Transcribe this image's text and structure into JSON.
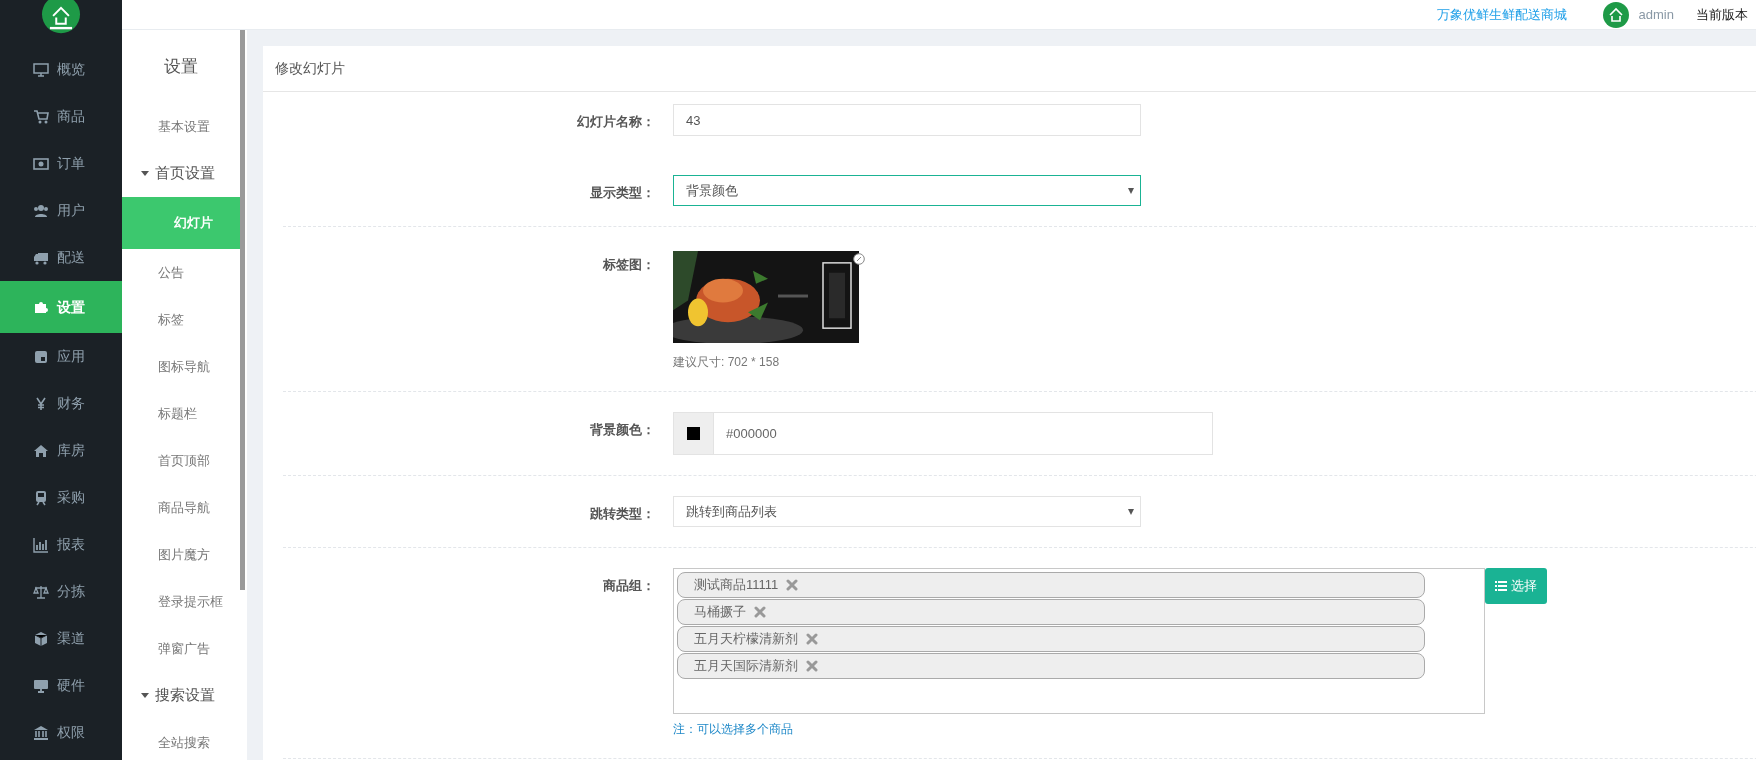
{
  "topbar": {
    "shop_link": "万象优鲜生鲜配送商城",
    "user": "admin",
    "version_label": "当前版本"
  },
  "nav": [
    {
      "label": "概览",
      "selected": false
    },
    {
      "label": "商品",
      "selected": false
    },
    {
      "label": "订单",
      "selected": false
    },
    {
      "label": "用户",
      "selected": false
    },
    {
      "label": "配送",
      "selected": false
    },
    {
      "label": "设置",
      "selected": true
    },
    {
      "label": "应用",
      "selected": false
    },
    {
      "label": "财务",
      "selected": false
    },
    {
      "label": "库房",
      "selected": false
    },
    {
      "label": "采购",
      "selected": false
    },
    {
      "label": "报表",
      "selected": false
    },
    {
      "label": "分拣",
      "selected": false
    },
    {
      "label": "渠道",
      "selected": false
    },
    {
      "label": "硬件",
      "selected": false
    },
    {
      "label": "权限",
      "selected": false
    }
  ],
  "subnav": {
    "title": "设置",
    "items": [
      {
        "label": "基本设置",
        "selected": false
      },
      {
        "label": "首页设置",
        "expanded": true,
        "children": [
          {
            "label": "幻灯片",
            "selected": true
          },
          {
            "label": "公告",
            "selected": false
          },
          {
            "label": "标签",
            "selected": false
          },
          {
            "label": "图标导航",
            "selected": false
          },
          {
            "label": "标题栏",
            "selected": false
          },
          {
            "label": "首页顶部",
            "selected": false
          },
          {
            "label": "商品导航",
            "selected": false
          },
          {
            "label": "图片魔方",
            "selected": false
          },
          {
            "label": "登录提示框",
            "selected": false
          },
          {
            "label": "弹窗广告",
            "selected": false
          }
        ]
      },
      {
        "label": "搜索设置",
        "expanded": true,
        "children": [
          {
            "label": "全站搜索",
            "selected": false
          }
        ]
      }
    ]
  },
  "card": {
    "title": "修改幻灯片",
    "fields": [
      {
        "kind": "text",
        "label": "幻灯片名称：",
        "value": "43"
      },
      {
        "kind": "select",
        "label": "显示类型：",
        "value": "背景颜色",
        "focused": true
      },
      {
        "label": "标签图：",
        "hint": "建议尺寸: 702 * 158"
      },
      {
        "kind": "color",
        "label": "背景颜色：",
        "value": "#000000",
        "color": "#000000"
      },
      {
        "kind": "select",
        "label": "跳转类型：",
        "value": "跳转到商品列表",
        "focused": false
      },
      {
        "kind": "tags",
        "label": "商品组：",
        "tags": [
          "测试商品11111",
          "马桶撅子",
          "五月天柠檬清新剂",
          "五月天国际清新剂"
        ],
        "button": "选择",
        "note": "注：可以选择多个商品"
      }
    ]
  }
}
